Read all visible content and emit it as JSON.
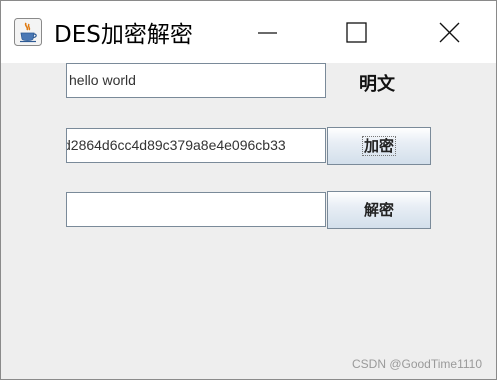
{
  "window": {
    "title": "DES加密解密",
    "icon": "java-cup-icon"
  },
  "controls": {
    "minimize": "minimize-icon",
    "maximize": "maximize-icon",
    "close": "close-icon"
  },
  "form": {
    "plaintext_value": "hello world",
    "plaintext_label": "明文",
    "ciphertext_value": "d2864d6cc4d89c379a8e4e096cb33",
    "encrypt_button": "加密",
    "decrypted_value": "",
    "decrypt_button": "解密"
  },
  "watermark": "CSDN @GoodTime1110",
  "colors": {
    "window_bg": "#eeeeee",
    "titlebar_bg": "#ffffff",
    "button_gradient_top": "#ffffff",
    "button_gradient_bottom": "#d3dfeb"
  }
}
